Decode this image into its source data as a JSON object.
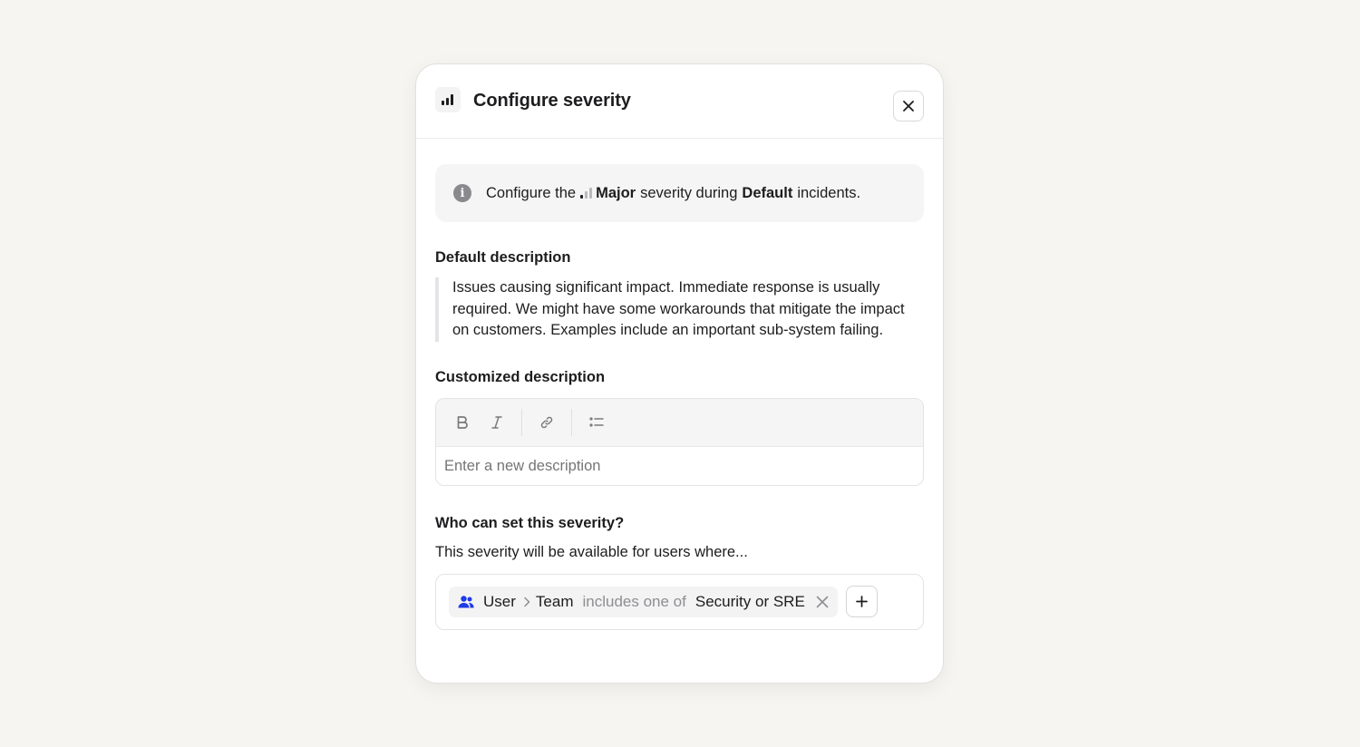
{
  "modal": {
    "title": "Configure severity",
    "close_icon": "close-icon",
    "header_icon": "severity-bars-icon"
  },
  "info": {
    "icon": "info-icon",
    "prefix": "Configure the",
    "severity_name": "Major",
    "middle": "severity during",
    "incident_type": "Default",
    "suffix": "incidents."
  },
  "default_description": {
    "label": "Default description",
    "text": "Issues causing significant impact. Immediate response is usually required. We might have some workarounds that mitigate the impact on customers. Examples include an important sub-system failing."
  },
  "customized_description": {
    "label": "Customized description",
    "toolbar": [
      "bold-icon",
      "italic-icon",
      "link-icon",
      "bulleted-list-icon"
    ],
    "placeholder": "Enter a new description",
    "value": ""
  },
  "who_can_set": {
    "label": "Who can set this severity?",
    "subtitle": "This severity will be available for users where...",
    "condition": {
      "icon": "users-icon",
      "subject": "User",
      "attribute": "Team",
      "operator": "includes one of",
      "value": "Security or SRE"
    },
    "add_icon": "plus-icon"
  },
  "colors": {
    "background": "#f7f5f1",
    "users_icon": "#1f3be8",
    "info_icon": "#8a8a8e"
  }
}
